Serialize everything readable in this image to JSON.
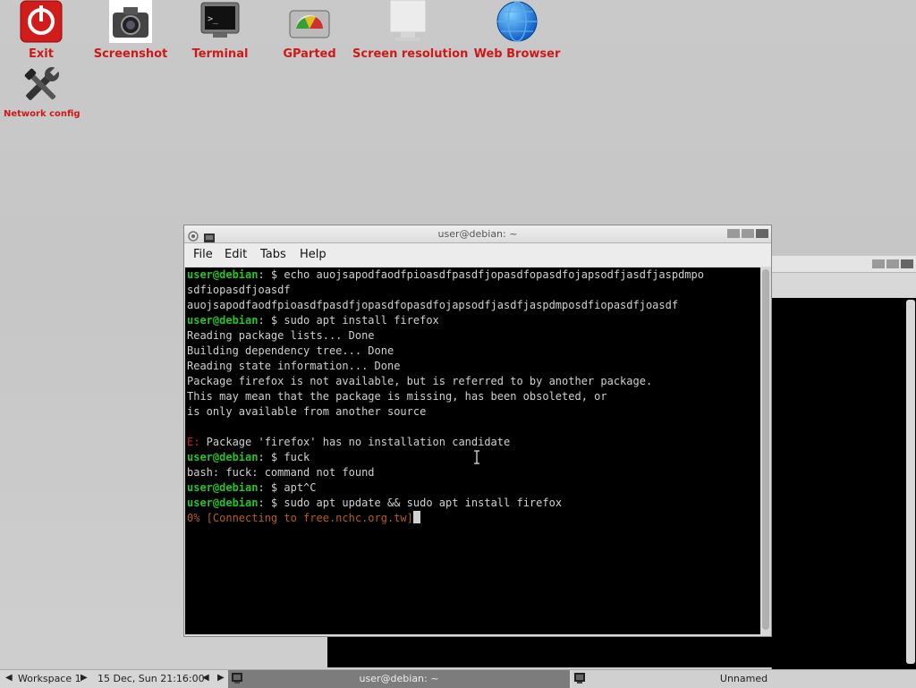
{
  "desktop": {
    "icons": [
      {
        "label": "Exit",
        "icon": "power-icon"
      },
      {
        "label": "Screenshot",
        "icon": "camera-icon"
      },
      {
        "label": "Terminal",
        "icon": "terminal-icon"
      },
      {
        "label": "GParted",
        "icon": "disk-icon"
      },
      {
        "label": "Screen resolution",
        "icon": "monitor-icon"
      },
      {
        "label": "Web Browser",
        "icon": "globe-icon"
      },
      {
        "label": "Network config",
        "icon": "tools-icon"
      }
    ]
  },
  "window": {
    "title": "user@debian: ~",
    "menu": [
      "File",
      "Edit",
      "Tabs",
      "Help"
    ]
  },
  "terminal": {
    "prompt": "user@debian",
    "lines": [
      {
        "prompt": "user@debian",
        "rest": ": $ echo auojsapodfaodfpioasdfpasdfjopasdfopasdfojapsodfjasdfjaspdmpo"
      },
      {
        "text": "sdfiopasdfjoasdf"
      },
      {
        "text": "auojsapodfaodfpioasdfpasdfjopasdfopasdfojapsodfjasdfjaspdmposdfiopasdfjoasdf"
      },
      {
        "prompt": "user@debian",
        "rest": ": $ sudo apt install firefox"
      },
      {
        "text": "Reading package lists... Done"
      },
      {
        "text": "Building dependency tree... Done"
      },
      {
        "text": "Reading state information... Done"
      },
      {
        "text": "Package firefox is not available, but is referred to by another package."
      },
      {
        "text": "This may mean that the package is missing, has been obsoleted, or"
      },
      {
        "text": "is only available from another source"
      },
      {
        "text": ""
      },
      {
        "error": "E:",
        "rest": " Package 'firefox' has no installation candidate"
      },
      {
        "prompt": "user@debian",
        "rest": ": $ fuck"
      },
      {
        "text": "bash: fuck: command not found"
      },
      {
        "prompt": "user@debian",
        "rest": ": $ apt^C"
      },
      {
        "prompt": "user@debian",
        "rest": ": $ sudo apt update && sudo apt install firefox"
      },
      {
        "progress": "0% [Connecting to free.nchc.org.tw]"
      }
    ]
  },
  "taskbar": {
    "workspace": "Workspace 1",
    "datetime": "15 Dec, Sun 21:16:00",
    "tasks": [
      "user@debian: ~",
      "Unnamed"
    ]
  },
  "colors": {
    "prompt": "#29c229",
    "error": "#c82323",
    "progress": "#b85f1c",
    "label": "#d01818"
  }
}
